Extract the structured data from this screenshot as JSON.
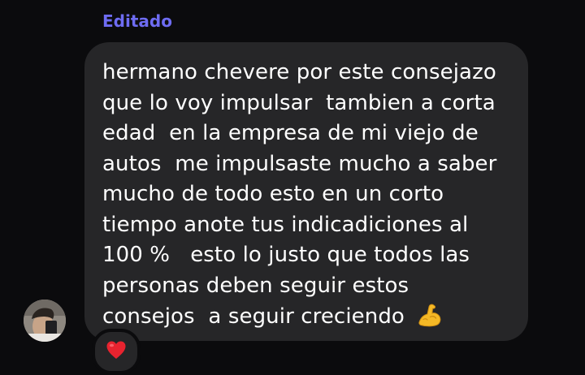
{
  "message": {
    "edited_label": "Editado",
    "lines": [
      "hermano chevere por este consejazo",
      "que lo voy impulsar  tambien a corta",
      "edad  en la empresa de mi viejo de",
      "autos  me impulsaste mucho a saber",
      "mucho de todo esto en un corto",
      "tiempo anote tus indicadiciones al",
      "100 %   esto lo justo que todos las",
      "personas deben seguir estos",
      "consejos  a seguir creciendo "
    ],
    "trailing_emoji": "flexed-biceps-emoji",
    "reaction": "red-heart-emoji"
  },
  "colors": {
    "background": "#0b0b0d",
    "bubble": "#262628",
    "edited_label": "#6e6cf2",
    "text": "#ffffff",
    "heart": "#e8232f",
    "biceps": "#f5b926"
  }
}
